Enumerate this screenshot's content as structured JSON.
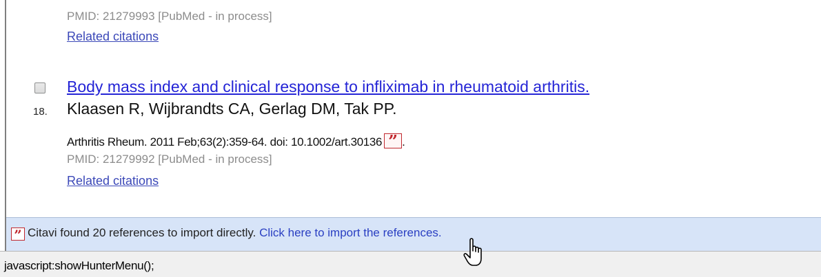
{
  "previous_result": {
    "pmid_line": "PMID: 21279993 [PubMed - in process]",
    "related_label": "Related citations"
  },
  "result": {
    "number": "18.",
    "title": "Body mass index and clinical response to infliximab in rheumatoid arthritis.",
    "authors": "Klaasen R, Wijbrandts CA, Gerlag DM, Tak PP.",
    "journal": "Arthritis Rheum. 2011 Feb;63(2):359-64. doi: 10.1002/art.30136",
    "journal_suffix": ".",
    "pmid_line": "PMID: 21279992 [PubMed - in process]",
    "related_label": "Related citations",
    "checked": false
  },
  "citavi_bar": {
    "message": "Citavi found 20 references to import directly.",
    "link": "Click here to import the references."
  },
  "status_bar": {
    "url": "javascript:showHunterMenu();"
  },
  "icons": {
    "citavi": "citavi-quote-icon",
    "cursor": "hand-pointer-icon"
  },
  "colors": {
    "title_link": "#2424d6",
    "related_link": "#3b48b8",
    "citavi_bar_bg": "#d7e4f8",
    "citavi_red": "#c0272d"
  }
}
